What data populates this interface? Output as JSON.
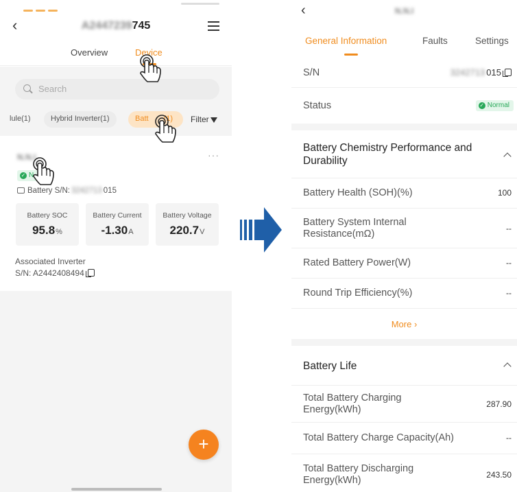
{
  "colors": {
    "accent": "#f08c1e",
    "success": "#27a858",
    "arrow": "#1f5fa8"
  },
  "left": {
    "header": {
      "title_blurred": "A2447239",
      "title_suffix": "745"
    },
    "tabs": [
      "Overview",
      "Device"
    ],
    "active_tab": "Device",
    "search": {
      "placeholder": "Search"
    },
    "chips": [
      "lule(1)",
      "Hybrid Inverter(1)",
      "Batt",
      "(1)"
    ],
    "filter_label": "Filter",
    "card": {
      "name_blurred": "N.N.I",
      "status_short": "N",
      "sn_label": "Battery S/N:",
      "sn_blurred": "3242713",
      "sn_suffix": "015",
      "metrics": [
        {
          "label": "Battery SOC",
          "value": "95.8",
          "unit": "%"
        },
        {
          "label": "Battery Current",
          "value": "-1.30",
          "unit": "A"
        },
        {
          "label": "Battery Voltage",
          "value": "220.7",
          "unit": "V"
        }
      ],
      "assoc_label": "Associated Inverter",
      "assoc_sn": "S/N: A2442408494"
    },
    "fab": "+"
  },
  "right": {
    "title_blurred": "N.N.I",
    "tabs": [
      "General Information",
      "Faults",
      "Settings"
    ],
    "active_tab": "General Information",
    "sn": {
      "label": "S/N",
      "value_blurred": "3242713",
      "value_suffix": "015"
    },
    "status": {
      "label": "Status",
      "value": "Normal"
    },
    "section1": {
      "title": "Battery Chemistry Performance and Durability",
      "rows": [
        {
          "label": "Battery Health (SOH)(%)",
          "value": "100"
        },
        {
          "label": "Battery System Internal Resistance(mΩ)",
          "value": "--"
        },
        {
          "label": "Rated Battery Power(W)",
          "value": "--"
        },
        {
          "label": "Round Trip Efficiency(%)",
          "value": "--"
        }
      ],
      "more": "More ›"
    },
    "section2": {
      "title": "Battery Life",
      "rows": [
        {
          "label": "Total Battery Charging Energy(kWh)",
          "value": "287.90"
        },
        {
          "label": "Total Battery Charge Capacity(Ah)",
          "value": "--"
        },
        {
          "label": "Total Battery Discharging Energy(kWh)",
          "value": "243.50"
        }
      ]
    }
  }
}
